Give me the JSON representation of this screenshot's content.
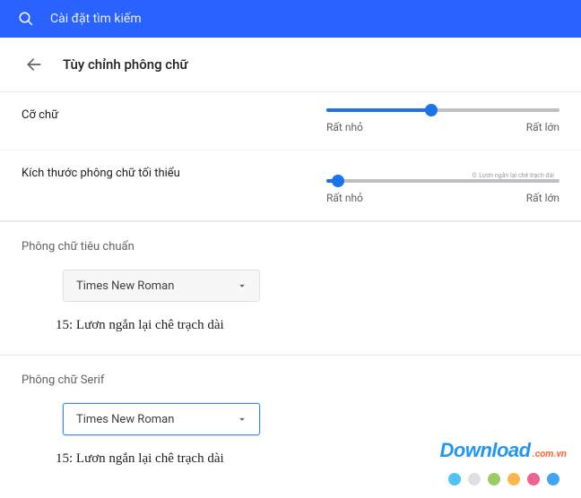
{
  "search": {
    "placeholder": "Cài đặt tìm kiếm"
  },
  "header": {
    "title": "Tùy chỉnh phông chữ"
  },
  "fontSize": {
    "label": "Cỡ chữ",
    "min_label": "Rất nhỏ",
    "max_label": "Rất lớn",
    "percent": 45
  },
  "minFontSize": {
    "label": "Kích thước phông chữ tối thiểu",
    "min_label": "Rất nhỏ",
    "max_label": "Rất lớn",
    "tiny_preview": "0: Lươn ngắn lại chê trạch dài",
    "percent": 5
  },
  "standardFont": {
    "title": "Phông chữ tiêu chuẩn",
    "value": "Times New Roman",
    "preview": "15: Lươn ngắn lại chê trạch dài"
  },
  "serifFont": {
    "title": "Phông chữ Serif",
    "value": "Times New Roman",
    "preview": "15: Lươn ngắn lại chê trạch dài"
  },
  "watermark": {
    "brand": "Download",
    "tld": ".com.vn"
  },
  "dots": [
    "#4fc3f7",
    "#e0e0e0",
    "#9ccc65",
    "#ffb74d",
    "#f06292",
    "#42a5f5"
  ]
}
